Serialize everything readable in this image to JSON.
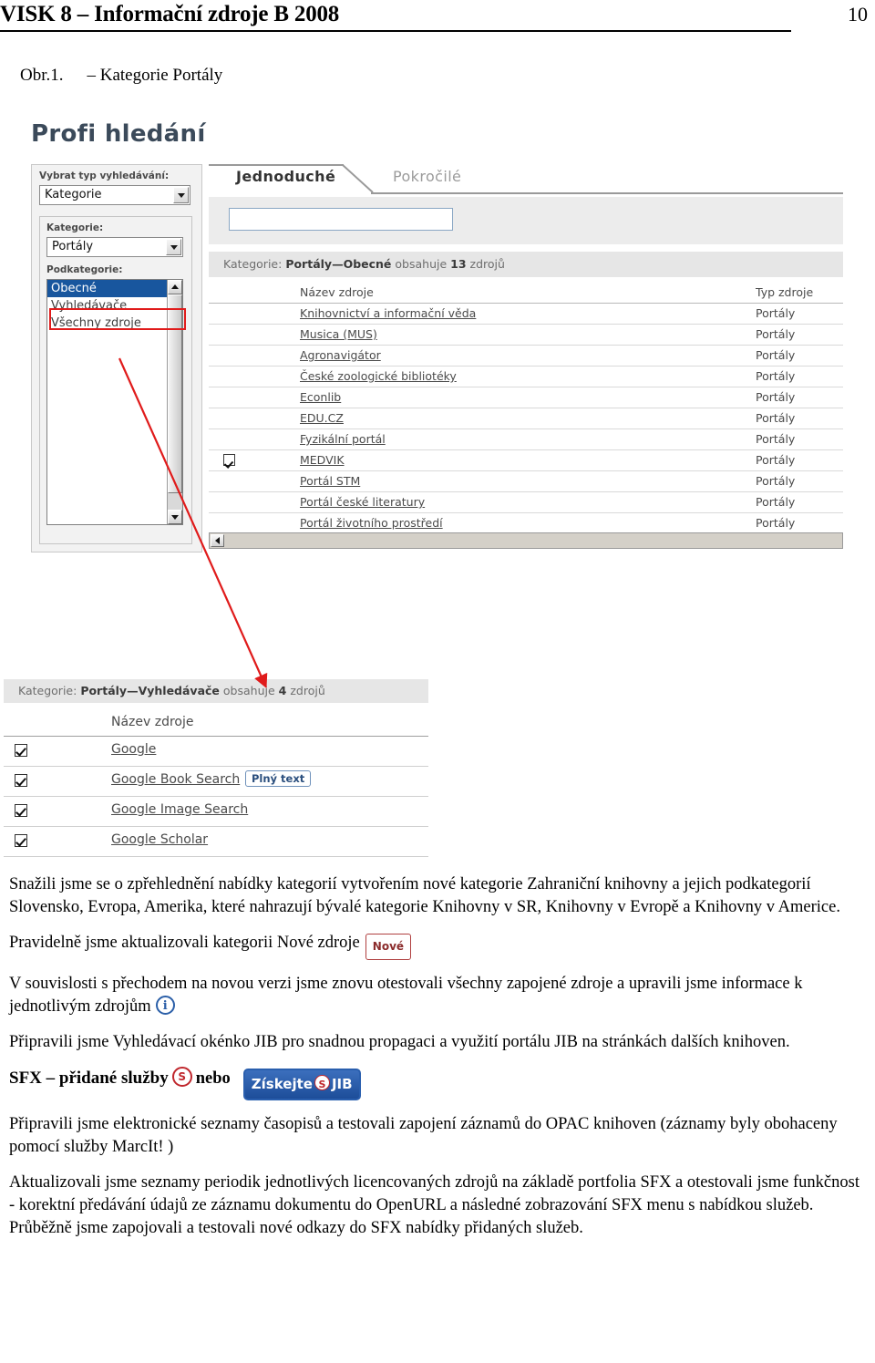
{
  "runhead": {
    "title": "VISK 8 – Informační zdroje B 2008",
    "page_number": "10"
  },
  "figure": {
    "number": "Obr.1.",
    "dash_title": "–  Kategorie Portály"
  },
  "screenshot_portal": {
    "app_title": "Profi hledání",
    "left_panel": {
      "search_type_label": "Vybrat typ vyhledávání:",
      "search_type_value": "Kategorie",
      "category_label": "Kategorie:",
      "category_value": "Portály",
      "subcategory_label": "Podkategorie:",
      "subcategory_items": [
        {
          "label": "Obecné",
          "selected": true
        },
        {
          "label": "Vyhledávače",
          "selected": false
        },
        {
          "label": "Všechny zdroje",
          "selected": false
        }
      ]
    },
    "tabs": [
      {
        "label": "Jednoduché",
        "active": true
      },
      {
        "label": "Pokročilé",
        "active": false
      }
    ],
    "search_input_value": "",
    "category_bar": {
      "prefix": "Kategorie:",
      "path": "Portály—Obecné",
      "middle": "obsahuje",
      "count": "13",
      "suffix": "zdrojů"
    },
    "table": {
      "columns": [
        "Název zdroje",
        "Typ zdroje"
      ],
      "rows": [
        {
          "checked": false,
          "name": "Knihovnictví a informační věda",
          "type": "Portály"
        },
        {
          "checked": false,
          "name": "Musica (MUS)",
          "type": "Portály"
        },
        {
          "checked": false,
          "name": "Agronavigátor",
          "type": "Portály"
        },
        {
          "checked": false,
          "name": "České zoologické bibliotéky",
          "type": "Portály"
        },
        {
          "checked": false,
          "name": "Econlib",
          "type": "Portály"
        },
        {
          "checked": false,
          "name": "EDU.CZ",
          "type": "Portály"
        },
        {
          "checked": false,
          "name": "Fyzikální portál",
          "type": "Portály"
        },
        {
          "checked": true,
          "name": "MEDVIK",
          "type": "Portály"
        },
        {
          "checked": false,
          "name": "Portál STM",
          "type": "Portály"
        },
        {
          "checked": false,
          "name": "Portál české literatury",
          "type": "Portály"
        },
        {
          "checked": false,
          "name": "Portál životního prostředí",
          "type": "Portály"
        }
      ]
    }
  },
  "screenshot_engines": {
    "category_bar": {
      "prefix": "Kategorie:",
      "path": "Portály—Vyhledávače",
      "middle": "obsahuje",
      "count": "4",
      "suffix": "zdrojů"
    },
    "table": {
      "column": "Název zdroje",
      "rows": [
        {
          "checked": true,
          "name": "Google",
          "badge": ""
        },
        {
          "checked": true,
          "name": "Google Book Search",
          "badge": "Plný text"
        },
        {
          "checked": true,
          "name": "Google Image Search",
          "badge": ""
        },
        {
          "checked": true,
          "name": "Google Scholar",
          "badge": ""
        }
      ]
    }
  },
  "body": {
    "p1": "Snažili jsme se o zpřehlednění nabídky kategorií vytvořením nové kategorie Zahraniční knihovny a jejich podkategorií Slovensko, Evropa, Amerika, které nahrazují bývalé kategorie Knihovny v SR, Knihovny v Evropě a Knihovny v Americe.",
    "p2_text": "Pravidelně jsme aktualizovali kategorii Nové zdroje",
    "p2_badge": "Nové",
    "p3_text": "V souvislosti s přechodem na novou verzi jsme znovu otestovali všechny zapojené zdroje a upravili jsme informace k jednotlivým zdrojům",
    "p4": "Připravili jsme Vyhledávací okénko JIB pro snadnou propagaci a využití  portálu JIB na stránkách dalších knihoven.",
    "p5_lead": "SFX – přidané služby",
    "p5_mid": "nebo",
    "p5_button_left": "Získejte",
    "p5_button_right": "JIB",
    "p6": "Připravili jsme elektronické seznamy časopisů a testovali zapojení  záznamů do OPAC knihoven (záznamy byly obohaceny pomocí služby  MarcIt! )",
    "p7": "Aktualizovali jsme seznamy periodik jednotlivých licencovaných zdrojů na základě portfolia SFX a otestovali jsme funkčnost - korektní předávání údajů ze záznamu dokumentu do OpenURL a následné zobrazování SFX menu s nabídkou služeb. Průběžně jsme  zapojovali a testovali nové odkazy do SFX nabídky přidaných služeb."
  }
}
